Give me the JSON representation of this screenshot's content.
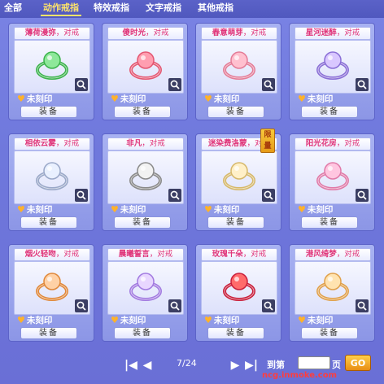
{
  "tabs": [
    {
      "label": "全部"
    },
    {
      "label": "动作戒指"
    },
    {
      "label": "特效戒指"
    },
    {
      "label": "文字戒指"
    },
    {
      "label": "其他戒指"
    }
  ],
  "items": [
    {
      "name": "薄荷漫弥",
      "suffix": "对戒",
      "status": "未刻印",
      "equip": "装备"
    },
    {
      "name": "傻时光",
      "suffix": "对戒",
      "status": "未刻印",
      "equip": "装备"
    },
    {
      "name": "春意萌芽",
      "suffix": "对戒",
      "status": "未刻印",
      "equip": "装备"
    },
    {
      "name": "星河迷醉",
      "suffix": "对戒",
      "status": "未刻印",
      "equip": "装备"
    },
    {
      "name": "相依云雾",
      "suffix": "对戒",
      "status": "未刻印",
      "equip": "装备"
    },
    {
      "name": "非凡",
      "suffix": "对戒",
      "status": "未刻印",
      "equip": "装备"
    },
    {
      "name": "迷染费洛蒙",
      "suffix": "对戒",
      "status": "未刻印",
      "equip": "装备",
      "badge": "限量"
    },
    {
      "name": "阳光花房",
      "suffix": "对戒",
      "status": "未刻印",
      "equip": "装备"
    },
    {
      "name": "烟火轻吻",
      "suffix": "对戒",
      "status": "未刻印",
      "equip": "装备"
    },
    {
      "name": "晨曦誓言",
      "suffix": "对戒",
      "status": "未刻印",
      "equip": "装备"
    },
    {
      "name": "玫瑰千朵",
      "suffix": "对戒",
      "status": "未刻印",
      "equip": "装备"
    },
    {
      "name": "港风绮梦",
      "suffix": "对戒",
      "status": "未刻印",
      "equip": "装备"
    }
  ],
  "pagination": {
    "page": "7/24",
    "goto_label": "到第",
    "page_unit": "页",
    "go_label": "GO",
    "input_value": ""
  },
  "watermark": "ncg.inmoke.com",
  "colors": {
    "accent": "#ffe46a",
    "name": "#e0357a",
    "heart": "#ffb22a"
  }
}
